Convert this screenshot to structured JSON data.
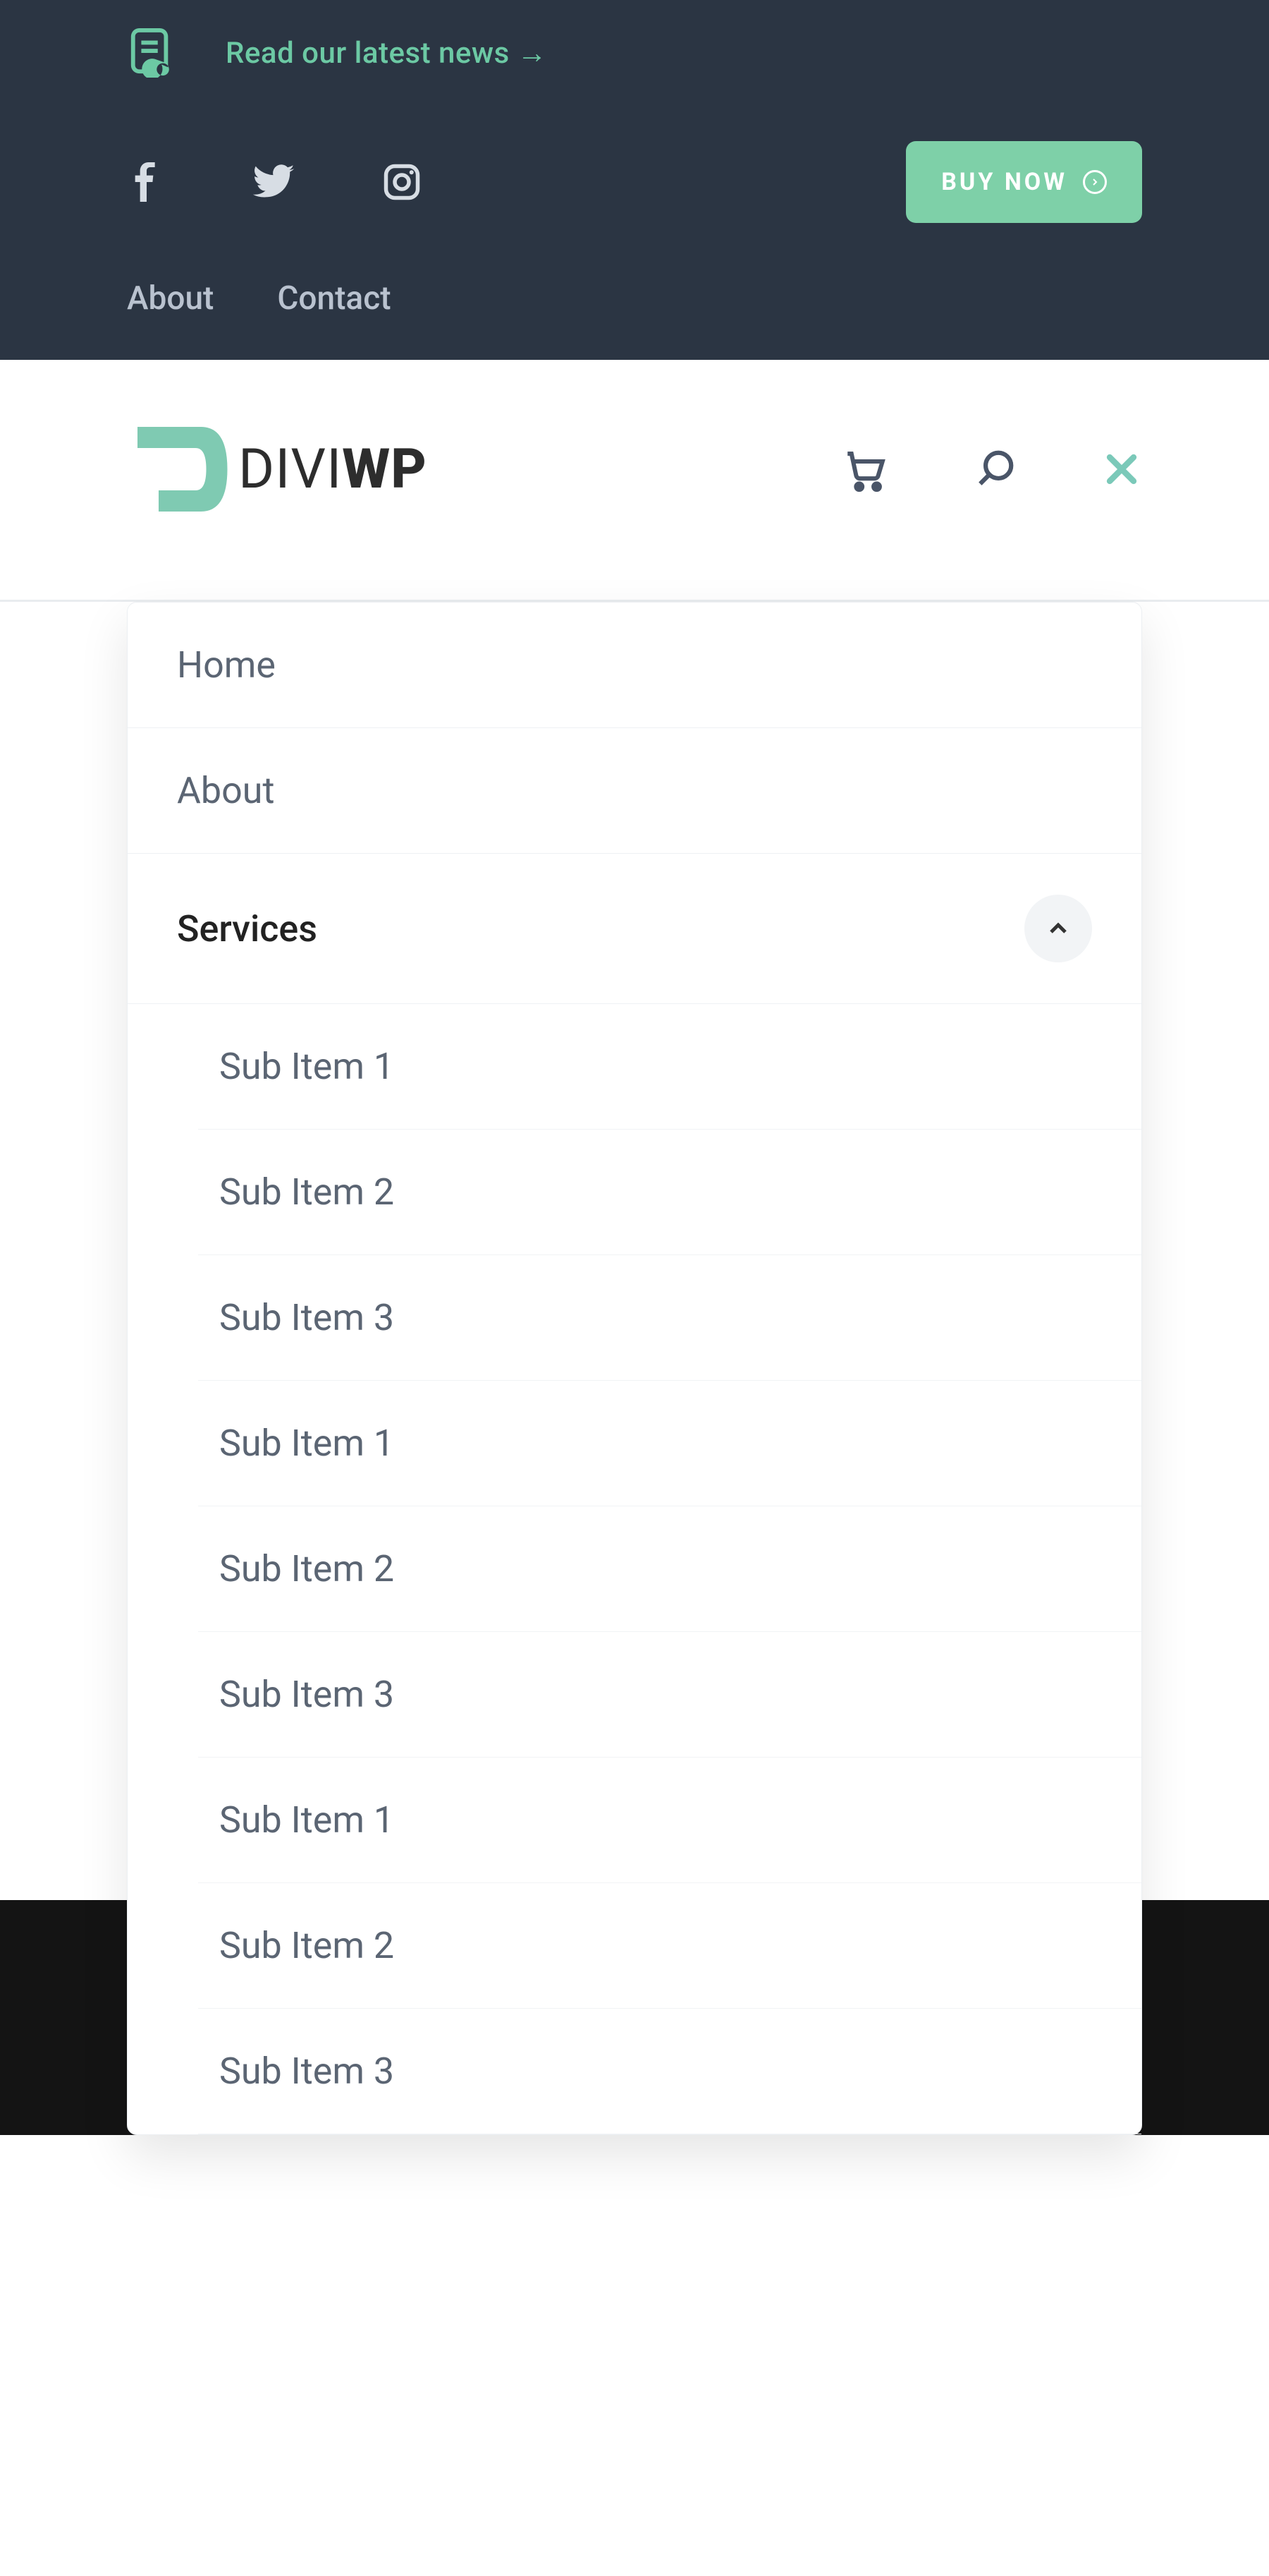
{
  "colors": {
    "accent": "#7ed0a8",
    "topbar_bg": "#2b3543",
    "text_muted": "#5b6573",
    "close_icon": "#7bc9b9"
  },
  "topbar": {
    "news_label": "Read our latest news →",
    "social": [
      "facebook",
      "twitter",
      "instagram"
    ],
    "buy_label": "BUY NOW",
    "nav": [
      {
        "label": "About"
      },
      {
        "label": "Contact"
      }
    ]
  },
  "header": {
    "logo_text_light": "DIVI",
    "logo_text_bold": "WP",
    "icons": [
      "cart",
      "search",
      "close"
    ]
  },
  "menu": {
    "items": [
      {
        "label": "Home"
      },
      {
        "label": "About"
      },
      {
        "label": "Services",
        "expanded": true
      }
    ],
    "services_sub": [
      "Sub Item 1",
      "Sub Item 2",
      "Sub Item 3",
      "Sub Item 1",
      "Sub Item 2",
      "Sub Item 3",
      "Sub Item 1",
      "Sub Item 2",
      "Sub Item 3"
    ]
  }
}
